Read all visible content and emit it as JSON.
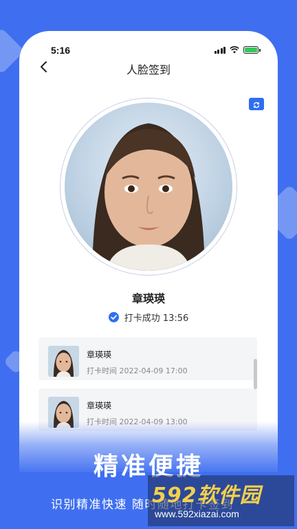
{
  "status_bar": {
    "time": "5:16"
  },
  "nav": {
    "title": "人脸签到"
  },
  "person": {
    "name": "章瑛瑛"
  },
  "checkin": {
    "status_text": "打卡成功 13:56"
  },
  "records": [
    {
      "name": "章瑛瑛",
      "time": "打卡时间 2022-04-09 17:00"
    },
    {
      "name": "章瑛瑛",
      "time": "打卡时间 2022-04-09 13:00"
    }
  ],
  "promo": {
    "title": "精准便捷",
    "subtitle": "识别精准快速 随时随地打卡签到"
  },
  "watermark": {
    "logo": "592软件园",
    "url": "www.592xiazai.com"
  },
  "colors": {
    "brand_blue": "#3f6ff0",
    "accent_blue": "#2f6ef0",
    "battery_green": "#35c759"
  },
  "icons": [
    "back-chevron-icon",
    "camera-switch-icon",
    "check-circle-icon",
    "signal-icon",
    "wifi-icon",
    "battery-icon"
  ]
}
